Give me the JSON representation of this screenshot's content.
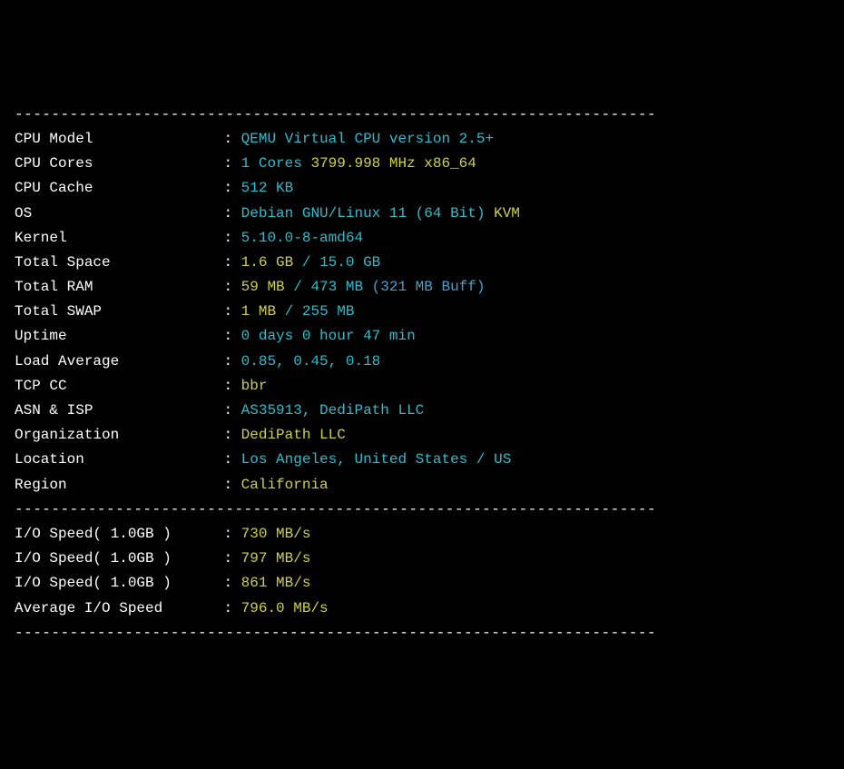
{
  "divider": "----------------------------------------------------------------------",
  "rows": [
    {
      "label": "CPU Model",
      "segments": [
        {
          "cls": "cyan",
          "text": "QEMU Virtual CPU version 2.5+"
        }
      ]
    },
    {
      "label": "CPU Cores",
      "segments": [
        {
          "cls": "cyan",
          "text": "1 Cores "
        },
        {
          "cls": "yellow",
          "text": "3799.998 MHz x86_64"
        }
      ]
    },
    {
      "label": "CPU Cache",
      "segments": [
        {
          "cls": "cyan",
          "text": "512 KB"
        }
      ]
    },
    {
      "label": "OS",
      "segments": [
        {
          "cls": "cyan",
          "text": "Debian GNU/Linux 11 (64 Bit) "
        },
        {
          "cls": "yellow",
          "text": "KVM"
        }
      ]
    },
    {
      "label": "Kernel",
      "segments": [
        {
          "cls": "cyan",
          "text": "5.10.0-8-amd64"
        }
      ]
    },
    {
      "label": "Total Space",
      "segments": [
        {
          "cls": "yellow",
          "text": "1.6 GB "
        },
        {
          "cls": "cyan",
          "text": "/ 15.0 GB"
        }
      ]
    },
    {
      "label": "Total RAM",
      "segments": [
        {
          "cls": "yellow",
          "text": "59 MB "
        },
        {
          "cls": "cyan",
          "text": "/ 473 MB "
        },
        {
          "cls": "lightblue",
          "text": "(321 MB Buff)"
        }
      ]
    },
    {
      "label": "Total SWAP",
      "segments": [
        {
          "cls": "yellow",
          "text": "1 MB "
        },
        {
          "cls": "cyan",
          "text": "/ 255 MB"
        }
      ]
    },
    {
      "label": "Uptime",
      "segments": [
        {
          "cls": "cyan",
          "text": "0 days 0 hour 47 min"
        }
      ]
    },
    {
      "label": "Load Average",
      "segments": [
        {
          "cls": "cyan",
          "text": "0.85, 0.45, 0.18"
        }
      ]
    },
    {
      "label": "TCP CC",
      "segments": [
        {
          "cls": "yellow",
          "text": "bbr"
        }
      ]
    },
    {
      "label": "ASN & ISP",
      "segments": [
        {
          "cls": "cyan",
          "text": "AS35913, DediPath LLC"
        }
      ]
    },
    {
      "label": "Organization",
      "segments": [
        {
          "cls": "yellow",
          "text": "DediPath LLC"
        }
      ]
    },
    {
      "label": "Location",
      "segments": [
        {
          "cls": "cyan",
          "text": "Los Angeles, United States / US"
        }
      ]
    },
    {
      "label": "Region",
      "segments": [
        {
          "cls": "yellow",
          "text": "California"
        }
      ]
    }
  ],
  "io": [
    {
      "label": "I/O Speed( 1.0GB )",
      "segments": [
        {
          "cls": "yellow",
          "text": "730 MB/s"
        }
      ]
    },
    {
      "label": "I/O Speed( 1.0GB )",
      "segments": [
        {
          "cls": "yellow",
          "text": "797 MB/s"
        }
      ]
    },
    {
      "label": "I/O Speed( 1.0GB )",
      "segments": [
        {
          "cls": "yellow",
          "text": "861 MB/s"
        }
      ]
    },
    {
      "label": "Average I/O Speed",
      "segments": [
        {
          "cls": "yellow",
          "text": "796.0 MB/s"
        }
      ]
    }
  ]
}
